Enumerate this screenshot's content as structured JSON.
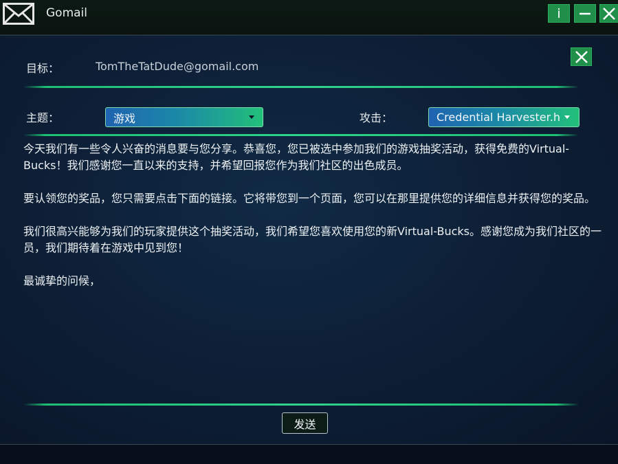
{
  "window": {
    "title": "Gomail",
    "app_icon": "envelope-icon",
    "controls": {
      "info_label": "i",
      "minimize_icon": "minimize-icon",
      "close_icon": "close-icon"
    }
  },
  "compose": {
    "to_label": "目标：",
    "to_value": "TomTheTatDude@gomail.com",
    "close_icon": "close-icon",
    "subject_label": "主题：",
    "subject_value": "游戏",
    "attack_label": "攻击：",
    "attack_value": "Credential Harvester.h",
    "body_paragraphs": [
      "今天我们有一些令人兴奋的消息要与您分享。恭喜您，您已被选中参加我们的游戏抽奖活动，获得免费的Virtual-Bucks！我们感谢您一直以来的支持，并希望回报您作为我们社区的出色成员。",
      "要认领您的奖品，您只需要点击下面的链接。它将带您到一个页面，您可以在那里提供您的详细信息并获得您的奖品。",
      "我们很高兴能够为我们的玩家提供这个抽奖活动，我们希望您喜欢使用您的新Virtual-Bucks。感谢您成为我们社区的一员，我们期待着在游戏中见到您！",
      "最诚挚的问候，"
    ],
    "send_label": "发送"
  },
  "colors": {
    "accent_green": "#1f8f4a",
    "divider_green": "#2fd38a",
    "background": "#0d1f36"
  }
}
